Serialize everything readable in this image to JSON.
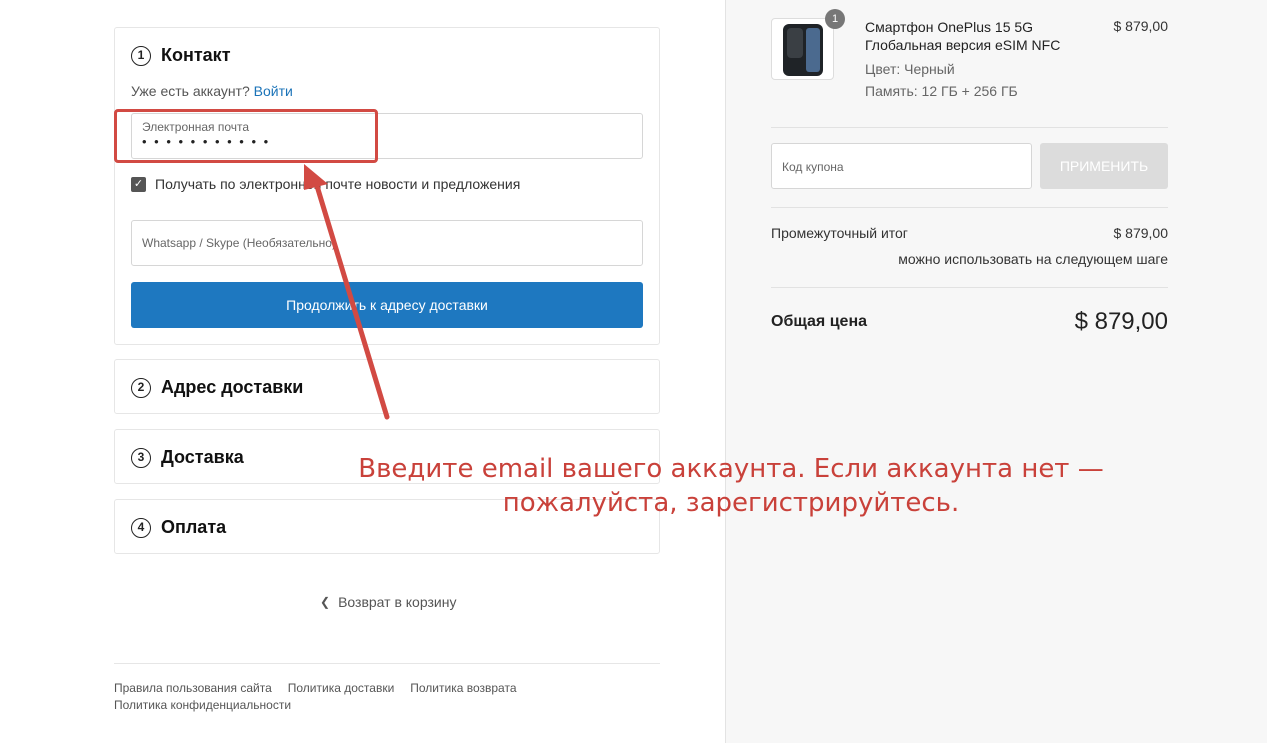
{
  "checkout": {
    "contact": {
      "step_number": "1",
      "title": "Контакт",
      "have_account_text": "Уже есть аккаунт?",
      "login_link": "Войти",
      "email_label": "Электронная почта",
      "email_value": "• • • • • • • • • • •",
      "newsletter_checked": true,
      "newsletter_label": "Получать по электронной почте новости и предложения",
      "whatsapp_placeholder": "Whatsapp / Skype (Необязательно)",
      "continue_button": "Продолжить к адресу доставки"
    },
    "steps": [
      {
        "number": "2",
        "title": "Адрес доставки"
      },
      {
        "number": "3",
        "title": "Доставка"
      },
      {
        "number": "4",
        "title": "Оплата"
      }
    ],
    "back_to_cart": "Возврат в корзину",
    "footer_links": [
      "Правила пользования сайта",
      "Политика доставки",
      "Политика возврата",
      "Политика конфиденциальности"
    ]
  },
  "annotation": {
    "text": "Введите email вашего аккаунта. Если аккаунта нет — пожалуйста, зарегистрируйтесь.",
    "color": "#d24a43"
  },
  "summary": {
    "product": {
      "quantity": "1",
      "name": "Смартфон OnePlus 15 5G Глобальная версия eSIM NFC",
      "price": "$ 879,00",
      "color": "Цвет: Черный",
      "memory": "Память: 12 ГБ + 256 ГБ"
    },
    "coupon_placeholder": "Код купона",
    "apply_button": "ПРИМЕНИТЬ",
    "subtotal_label": "Промежуточный итог",
    "subtotal_value": "$ 879,00",
    "shipping_note": "можно использовать на следующем шаге",
    "total_label": "Общая цена",
    "total_value": "$ 879,00"
  },
  "colors": {
    "primary_button": "#1e78c0",
    "link": "#1a73b8",
    "apply_disabled": "#dcdcdc",
    "sidebar_bg": "#f7f7f7"
  }
}
